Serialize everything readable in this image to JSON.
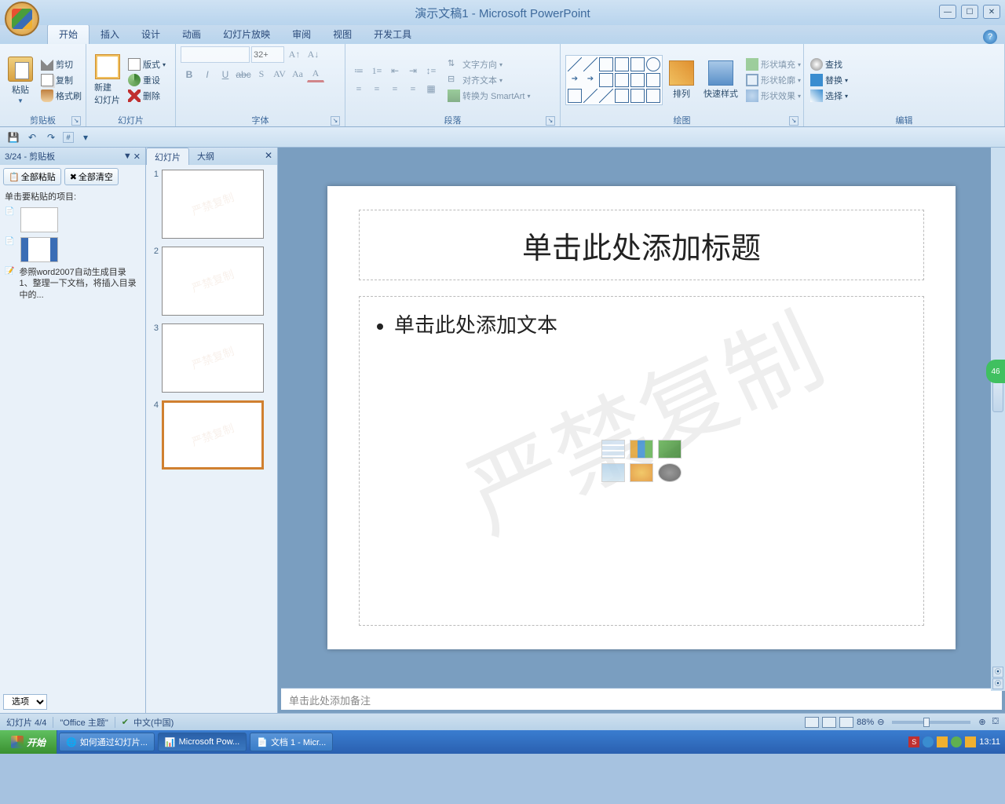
{
  "title": "演示文稿1 - Microsoft PowerPoint",
  "tabs": [
    "开始",
    "插入",
    "设计",
    "动画",
    "幻灯片放映",
    "审阅",
    "视图",
    "开发工具"
  ],
  "groups": {
    "clipboard": {
      "label": "剪贴板",
      "paste": "粘贴",
      "cut": "剪切",
      "copy": "复制",
      "brush": "格式刷"
    },
    "slides": {
      "label": "幻灯片",
      "new": "新建\n幻灯片",
      "layout": "版式",
      "reset": "重设",
      "delete": "删除"
    },
    "font": {
      "label": "字体",
      "size": "32+"
    },
    "paragraph": {
      "label": "段落",
      "dir": "文字方向",
      "align": "对齐文本",
      "smart": "转换为 SmartArt"
    },
    "drawing": {
      "label": "绘图",
      "arrange": "排列",
      "quick": "快速样式",
      "fill": "形状填充",
      "outline": "形状轮廓",
      "effects": "形状效果"
    },
    "editing": {
      "label": "编辑",
      "find": "查找",
      "replace": "替换",
      "select": "选择"
    }
  },
  "clipboardPane": {
    "header": "3/24 - 剪贴板",
    "pasteAll": "全部粘贴",
    "clearAll": "全部清空",
    "hint": "单击要粘贴的项目:",
    "item3": "参照word2007自动生成目录 1、整理一下文档，将插入目录中的...",
    "options": "选项"
  },
  "slidePane": {
    "tab1": "幻灯片",
    "tab2": "大纲"
  },
  "watermark": "严禁复制",
  "slide": {
    "title": "单击此处添加标题",
    "body": "单击此处添加文本"
  },
  "notes": "单击此处添加备注",
  "status": {
    "slide": "幻灯片 4/4",
    "theme": "\"Office 主题\"",
    "lang": "中文(中国)",
    "zoom": "88%"
  },
  "taskbar": {
    "start": "开始",
    "t1": "如何通过幻灯片...",
    "t2": "Microsoft Pow...",
    "t3": "文档 1 - Micr...",
    "time": "13:11"
  },
  "badge": "46"
}
